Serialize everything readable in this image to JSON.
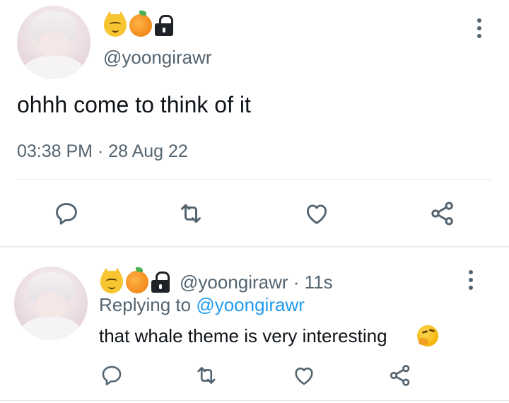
{
  "main_tweet": {
    "handle": "@yoongirawr",
    "text": "ohhh come to think of it",
    "timestamp": "03:38 PM · 28 Aug 22",
    "name_emojis": [
      "cat-face-icon",
      "tangerine-icon",
      "lock-icon"
    ]
  },
  "reply": {
    "handle": "@yoongirawr",
    "time": "· 11s",
    "replying_prefix": "Replying to",
    "replying_to": "@yoongirawr",
    "text": "that whale theme is very interesting",
    "text_emoji": "thinking-face-icon"
  },
  "actions": [
    "reply-icon",
    "retweet-icon",
    "like-icon",
    "share-icon"
  ],
  "colors": {
    "icon": "#536471",
    "text": "#0f1419",
    "link": "#1d9bf0",
    "divider": "#e1e5e8"
  }
}
